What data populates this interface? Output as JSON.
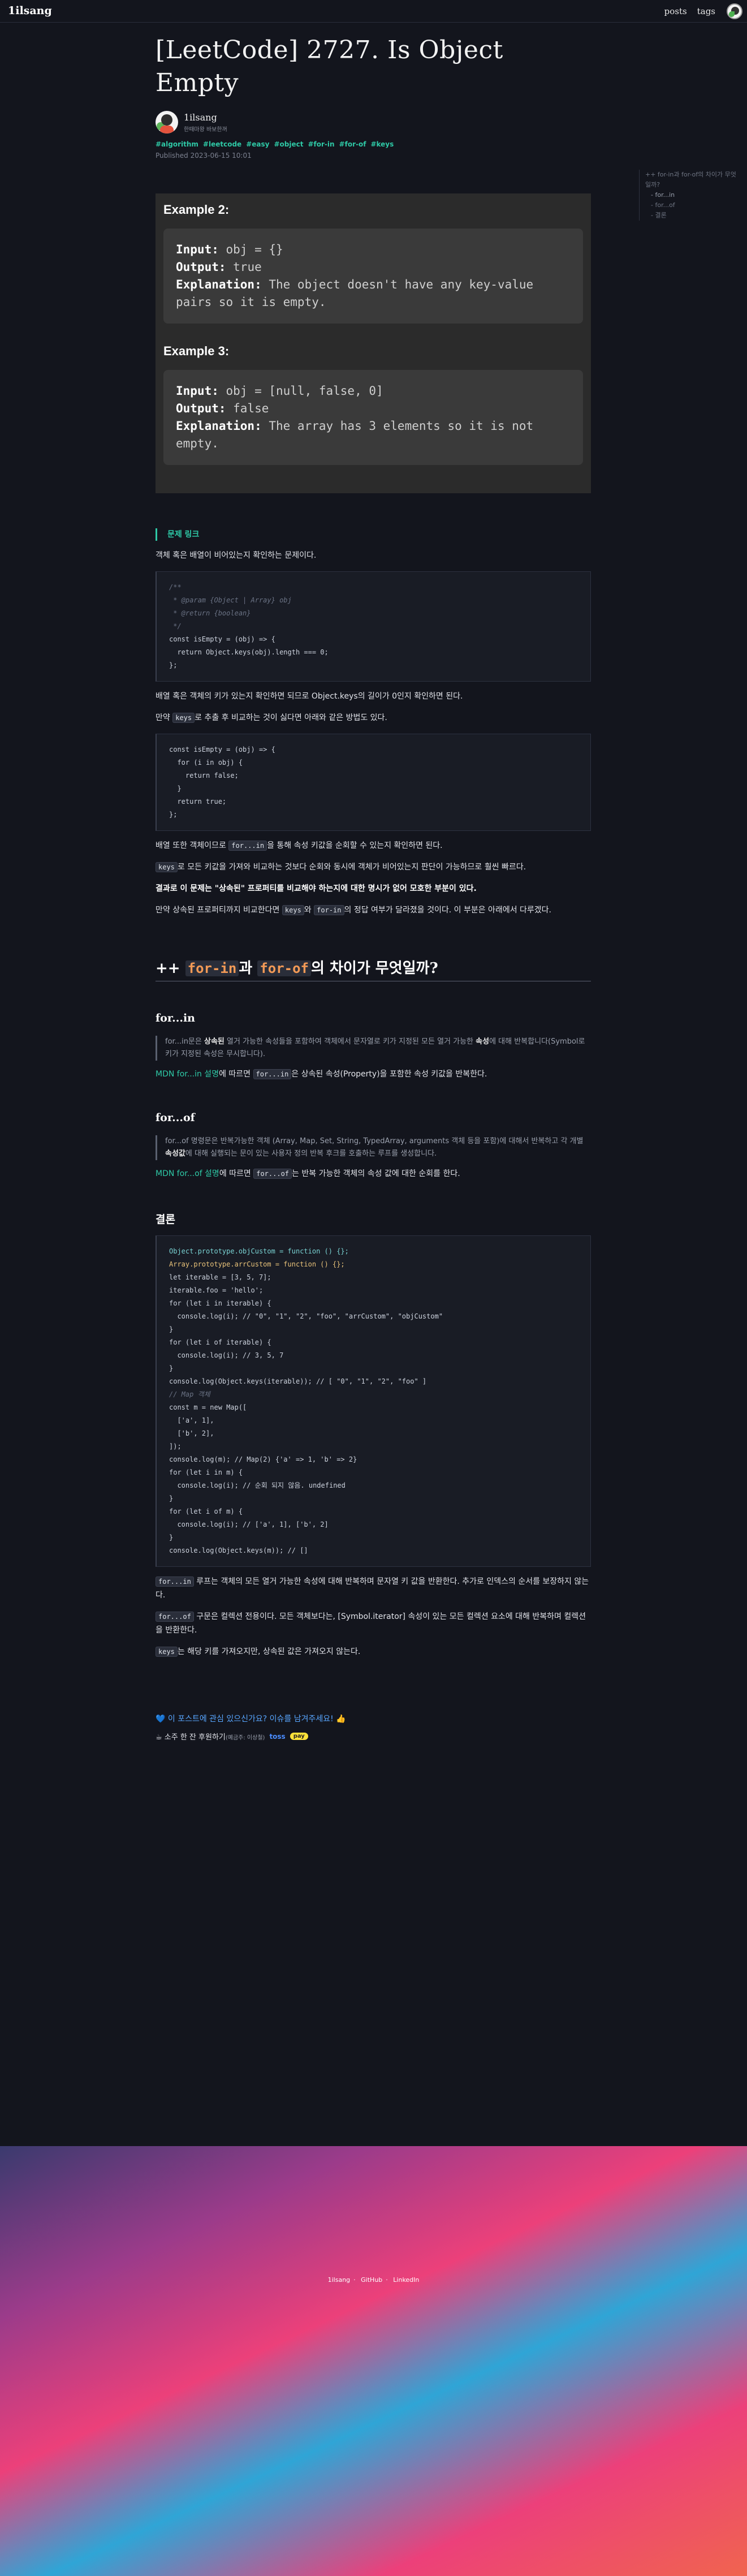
{
  "nav": {
    "brand": "1ilsang",
    "links": [
      "posts",
      "tags"
    ]
  },
  "post": {
    "title": "[LeetCode] 2727. Is Object Empty",
    "author_name": "1ilsang",
    "author_bio": "한때마왕 바보한꺼",
    "tags": [
      "#algorithm",
      "#leetcode",
      "#easy",
      "#object",
      "#for-in",
      "#for-of",
      "#keys"
    ],
    "published": "Published 2023-06-15 10:01"
  },
  "problem_image": {
    "example2": {
      "heading": "Example 2:",
      "input_label": "Input:",
      "input_value": " obj = {}",
      "output_label": "Output:",
      "output_value": " true",
      "explanation_label": "Explanation:",
      "explanation_value": " The object doesn't have any key-value pairs so it is empty."
    },
    "example3": {
      "heading": "Example 3:",
      "input_label": "Input:",
      "input_value": " obj = [null, false, 0]",
      "output_label": "Output:",
      "output_value": " false",
      "explanation_label": "Explanation:",
      "explanation_value": " The array has 3 elements so it is not empty."
    }
  },
  "content": {
    "problem_link": "문제 링크",
    "intro": "객체 혹은 배열이 비어있는지 확인하는 문제이다.",
    "code1": [
      "/**",
      " * @param {Object | Array} obj",
      " * @return {boolean}",
      " */",
      "const isEmpty = (obj) => {",
      "  return Object.keys(obj).length === 0;",
      "};"
    ],
    "p1": "배열 혹은 객체의 키가 있는지 확인하면 되므로 Object.keys의 길이가 0인지 확인하면 된다.",
    "p2_pre": "만약 ",
    "p2_code": "keys",
    "p2_post": "로 추출 후 비교하는 것이 싫다면 아래와 같은 방법도 있다.",
    "code2": [
      "const isEmpty = (obj) => {",
      "  for (i in obj) {",
      "    return false;",
      "  }",
      "  return true;",
      "};"
    ],
    "p3_pre": "배열 또한 객체이므로 ",
    "p3_code": "for...in",
    "p3_post": "을 통해 속성 키값을 순회할 수 있는지 확인하면 된다.",
    "p4_code": "keys",
    "p4_post": "로 모든 키값을 가져와 비교하는 것보다 순회와 동시에 객체가 비어있는지 판단이 가능하므로 훨씬 빠르다.",
    "p5": "결과로 이 문제는 \"상속된\" 프로퍼티를 비교해야 하는지에 대한 명시가 없어 모호한 부분이 있다.",
    "p6_pre": "만약 상속된 프로퍼티까지 비교한다면 ",
    "p6_code1": "keys",
    "p6_mid": "와 ",
    "p6_code2": "for-in",
    "p6_post": "의 정답 여부가 달라졌을 것이다. 이 부분은 아래에서 다루겠다.",
    "h2_pre": "++ ",
    "h2_code1": "for-in",
    "h2_mid": "과 ",
    "h2_code2": "for-of",
    "h2_post": "의 차이가 무엇일까?",
    "forin_heading": "for...in",
    "forin_quote_a": "for...in문은 ",
    "forin_quote_b": "상속된",
    "forin_quote_c": " 열거 가능한 속성들을 포함하여 객체에서 문자열로 키가 지정된 모든 열거 가능한 ",
    "forin_quote_d": "속성",
    "forin_quote_e": "에 대해 반복합니다(Symbol로 키가 지정된 속성은 무시합니다).",
    "forin_mdn_link": "MDN for...in 설명",
    "forin_mdn_mid": "에 따르면 ",
    "forin_mdn_code": "for...in",
    "forin_mdn_post": "은 상속된 속성(Property)을 포함한 속성 키값을 반복한다.",
    "forof_heading": "for...of",
    "forof_quote_a": "for...of 명령문은 반복가능한 객체 (Array, Map, Set, String, TypedArray, arguments 객체 등을 포함)에 대해서 반복하고 각 개별 ",
    "forof_quote_b": "속성값",
    "forof_quote_c": "에 대해 실행되는 문이 있는 사용자 정의 반복 후크를 호출하는 루프를 생성합니다.",
    "forof_mdn_link": "MDN for...of 설명",
    "forof_mdn_mid": "에 따르면 ",
    "forof_mdn_code": "for...of",
    "forof_mdn_post": "는 반복 가능한 객체의 속성 값에 대한 순회를 한다.",
    "conclusion_heading": "결론",
    "code3": [
      "Object.prototype.objCustom = function () {};",
      "Array.prototype.arrCustom = function () {};",
      "",
      "let iterable = [3, 5, 7];",
      "iterable.foo = 'hello';",
      "",
      "for (let i in iterable) {",
      "  console.log(i); // \"0\", \"1\", \"2\", \"foo\", \"arrCustom\", \"objCustom\"",
      "}",
      "for (let i of iterable) {",
      "  console.log(i); // 3, 5, 7",
      "}",
      "console.log(Object.keys(iterable)); // [ \"0\", \"1\", \"2\", \"foo\" ]",
      "",
      "// Map 객체",
      "const m = new Map([",
      "  ['a', 1],",
      "  ['b', 2],",
      "]);",
      "console.log(m); // Map(2) {'a' => 1, 'b' => 2}",
      "for (let i in m) {",
      "  console.log(i); // 순회 되지 않음. undefined",
      "}",
      "for (let i of m) {",
      "  console.log(i); // ['a', 1], ['b', 2]",
      "}",
      "console.log(Object.keys(m)); // []"
    ],
    "c1_code": "for...in",
    "c1_post": " 루프는 객체의 모든 열거 가능한 속성에 대해 반복하며 문자열 키 값을 반환한다. 추가로 인덱스의 순서를 보장하지 않는다.",
    "c2_code": "for...of",
    "c2_post": " 구문은 컬렉션 전용이다. 모든 객체보다는, [Symbol.iterator] 속성이 있는 모든 컬렉션 요소에 대해 반복하며 컬렉션을 반환한다.",
    "c3_code": "keys",
    "c3_post": "는 해당 키를 가져오지만, 상속된 값은 가져오지 않는다.",
    "share": "💙 이 포스트에 관심 있으신가요? 이슈를 남겨주세요! 👍",
    "support_text": "☕ 소주 한 잔 후원하기",
    "support_small": "(예금주: 이상철)",
    "toss": "toss",
    "kpay": "pay"
  },
  "toc": {
    "title": "++ for-in과 for-of의 차이가 무엇일까?",
    "items": [
      "for...in",
      "for...of",
      "결론"
    ]
  },
  "footer": {
    "links": [
      "1ilsang",
      "GitHub",
      "LinkedIn"
    ]
  }
}
